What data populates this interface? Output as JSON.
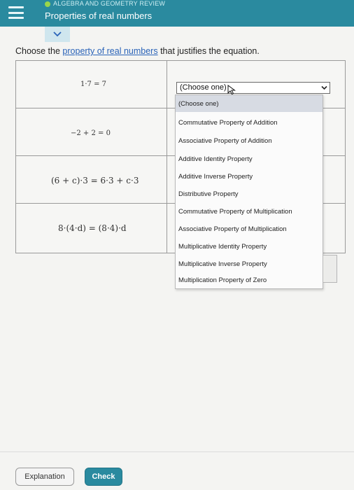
{
  "header": {
    "section": "ALGEBRA AND GEOMETRY REVIEW",
    "topic": "Properties of real numbers"
  },
  "instruction": {
    "before": "Choose the ",
    "link": "property of real numbers",
    "after": " that justifies the equation."
  },
  "equations": [
    "1·7 = 7",
    "−2 + 2 = 0",
    "(6 + c)·3 = 6·3 + c·3",
    "8·(4·d) = (8·4)·d"
  ],
  "select": {
    "value": "(Choose one)"
  },
  "dropdown": {
    "options": [
      "(Choose one)",
      "Commutative Property of Addition",
      "Associative Property of Addition",
      "Additive Identity Property",
      "Additive Inverse Property",
      "Distributive Property",
      "Commutative Property of Multiplication",
      "Associative Property of Multiplication",
      "Multiplicative Identity Property",
      "Multiplicative Inverse Property",
      "Multiplication Property of Zero"
    ],
    "selected_index": 0
  },
  "buttons": {
    "explanation": "Explanation",
    "check": "Check"
  },
  "colors": {
    "header": "#2a8a9f",
    "accent_dot": "#9ad64a",
    "link": "#2a63b8",
    "option_highlight": "#d7dbe3"
  },
  "icons": [
    "menu-icon",
    "chevron-down-icon",
    "select-arrow-icon",
    "mouse-pointer-icon"
  ]
}
